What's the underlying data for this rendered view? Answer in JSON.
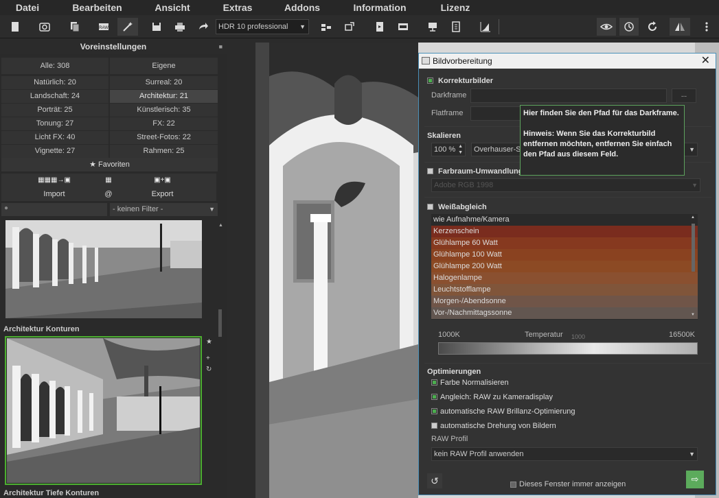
{
  "menu": [
    "Datei",
    "Bearbeiten",
    "Ansicht",
    "Extras",
    "Addons",
    "Information",
    "Lizenz"
  ],
  "toolbar": {
    "preset": "HDR 10 professional"
  },
  "left_panel": {
    "title": "Voreinstellungen",
    "tabs": [
      "Alle: 308",
      "Eigene"
    ],
    "categories": [
      [
        "Natürlich: 20",
        "Surreal: 20"
      ],
      [
        "Landschaft: 24",
        "Architektur: 21"
      ],
      [
        "Porträt: 25",
        "Künstlerisch: 35"
      ],
      [
        "Tonung: 27",
        "FX: 22"
      ],
      [
        "Licht FX: 40",
        "Street-Fotos: 22"
      ],
      [
        "Vignette: 27",
        "Rahmen: 25"
      ]
    ],
    "favorites": "★ Favoriten",
    "import_label": "Import",
    "at_label": "@",
    "export_label": "Export",
    "filter": "- keinen Filter -",
    "preset_label_1": "Architektur Konturen",
    "preset_label_2": "Architektur Tiefe Konturen"
  },
  "dialog": {
    "title": "Bildvorbereitung",
    "close": "✕",
    "korrektur": {
      "heading": "Korrekturbilder",
      "darkframe": "Darkframe",
      "flatframe": "Flatframe",
      "browse": "..."
    },
    "skalieren": {
      "heading": "Skalieren",
      "percent": "100 %",
      "method": "Overhauser-Sp"
    },
    "farbraum": {
      "heading": "Farbraum-Umwandlung",
      "profile": "Adobe RGB 1998"
    },
    "weissabgleich": {
      "heading": "Weißabgleich",
      "items": [
        {
          "label": "wie Aufnahme/Kamera",
          "color": "#2a2a2a"
        },
        {
          "label": "Kerzenschein",
          "color": "#7a2c1e"
        },
        {
          "label": "Glühlampe 60 Watt",
          "color": "#86391f"
        },
        {
          "label": "Glühlampe 100 Watt",
          "color": "#8a4220"
        },
        {
          "label": "Glühlampe 200 Watt",
          "color": "#8c4a24"
        },
        {
          "label": "Halogenlampe",
          "color": "#8a5030"
        },
        {
          "label": "Leuchtstofflampe",
          "color": "#80553a"
        },
        {
          "label": "Morgen-/Abendsonne",
          "color": "#705548"
        },
        {
          "label": "Vor-/Nachmittagssonne",
          "color": "#625650"
        }
      ],
      "temp_min": "1000K",
      "temp_label": "Temperatur",
      "temp_value": "1000",
      "temp_max": "16500K"
    },
    "optimierungen": {
      "heading": "Optimierungen",
      "options": [
        {
          "label": "Farbe Normalisieren",
          "checked": true
        },
        {
          "label": "Angleich: RAW zu Kameradisplay",
          "checked": true
        },
        {
          "label": "automatische RAW Brillanz-Optimierung",
          "checked": true
        },
        {
          "label": "automatische Drehung von Bildern",
          "checked": false
        }
      ],
      "raw_profile_label": "RAW Profil",
      "raw_profile": "kein RAW Profil anwenden"
    },
    "footer": {
      "show_always": "Dieses Fenster immer anzeigen",
      "go": "⇨",
      "undo": "↺"
    }
  },
  "tooltip": {
    "line1": "Hier finden Sie den Pfad für das Darkframe.",
    "line2": "Hinweis: Wenn Sie das Korrekturbild entfernen möchten, entfernen Sie einfach den Pfad aus diesem Feld."
  }
}
